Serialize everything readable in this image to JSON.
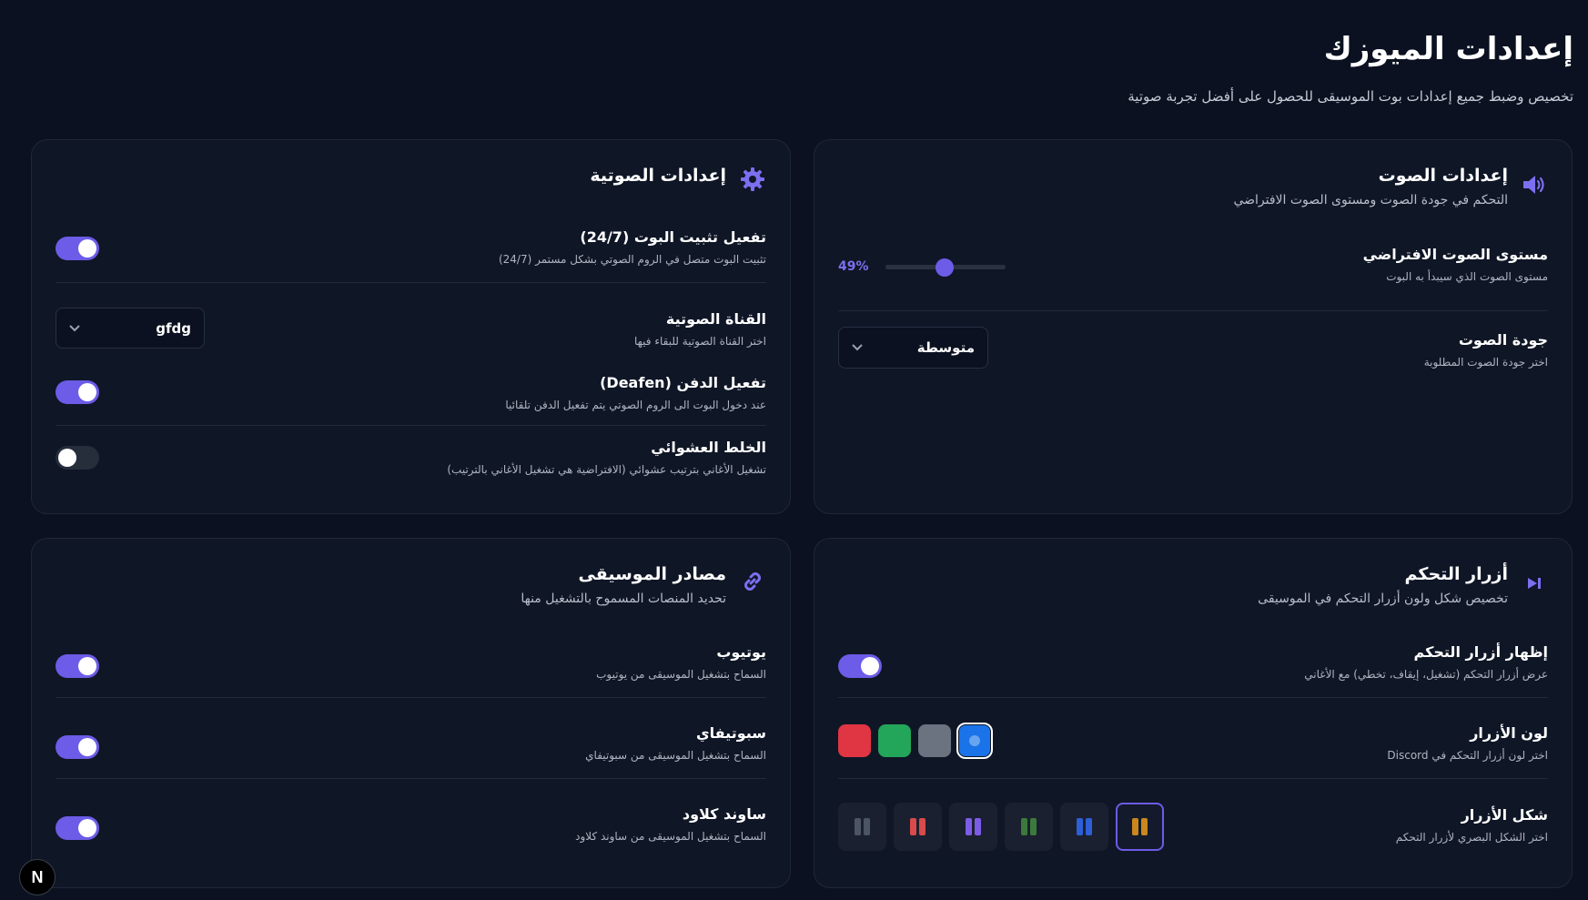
{
  "header": {
    "title": "إعدادات الميوزك",
    "subtitle": "تخصيص وضبط جميع إعدادات بوت الموسيقى للحصول على أفضل تجربة صوتية"
  },
  "audio_card": {
    "icon": "speaker-icon",
    "title": "إعدادات الصوت",
    "desc": "التحكم في جودة الصوت ومستوى الصوت الافتراضي",
    "volume": {
      "label": "مستوى الصوت الافتراضي",
      "desc": "مستوى الصوت الذي سيبدأ به البوت",
      "value": 49,
      "value_text": "49%"
    },
    "quality": {
      "label": "جودة الصوت",
      "desc": "اختر جودة الصوت المطلوبة",
      "value": "متوسطة"
    }
  },
  "voice_card": {
    "icon": "gear-icon",
    "title": "إعدادات الصوتية",
    "stay": {
      "label": "تفعيل تثبيت البوت (24/7)",
      "desc": "تثبيت البوت متصل في الروم الصوتي بشكل مستمر (24/7)",
      "on": true
    },
    "channel": {
      "label": "القناة الصوتية",
      "desc": "اختر القناة الصوتية للبقاء فيها",
      "value": "gfdg"
    },
    "deafen": {
      "label": "تفعيل الدفن (Deafen)",
      "desc": "عند دخول البوت الى الروم الصوتي يتم تفعيل الدفن تلقائيا",
      "on": true
    },
    "shuffle": {
      "label": "الخلط العشوائي",
      "desc": "تشغيل الأغاني بترتيب عشوائي (الافتراضية هي تشغيل الأغاني بالترتيب)",
      "on": false
    }
  },
  "control_card": {
    "icon": "skip-forward-icon",
    "title": "أزرار التحكم",
    "desc": "تخصيص شكل ولون أزرار التحكم في الموسيقى",
    "show": {
      "label": "إظهار أزرار التحكم",
      "desc": "عرض أزرار التحكم (تشغيل، إيقاف، تخطي) مع الأغاني",
      "on": true
    },
    "color": {
      "label": "لون الأزرار",
      "desc": "اختر لون أزرار التحكم في Discord",
      "options": [
        "#e03543",
        "#23a55a",
        "#6b7280",
        "#1a73e8"
      ],
      "selected_index": 3
    },
    "shape": {
      "label": "شكل الأزرار",
      "desc": "اختر الشكل البصري لأزرار التحكم",
      "options": [
        [
          "#4b5563",
          "#4b5563"
        ],
        [
          "#d94a4a",
          "#d94a4a"
        ],
        [
          "#7c5ce7",
          "#7c5ce7"
        ],
        [
          "#3b7a3b",
          "#3b7a3b"
        ],
        [
          "#2d5fd6",
          "#2d5fd6"
        ],
        [
          "#c9871d",
          "#c9871d"
        ]
      ],
      "selected_index": 5
    }
  },
  "sources_card": {
    "icon": "link-icon",
    "title": "مصادر الموسيقى",
    "desc": "تحديد المنصات المسموح بالتشغيل منها",
    "youtube": {
      "label": "يوتيوب",
      "desc": "السماح بتشغيل الموسيقى من يوتيوب",
      "on": true
    },
    "spotify": {
      "label": "سبوتيفاي",
      "desc": "السماح بتشغيل الموسيقى من سبوتيفاي",
      "on": true
    },
    "soundcloud": {
      "label": "ساوند كلاود",
      "desc": "السماح بتشغيل الموسيقى من ساوند كلاود",
      "on": true
    }
  },
  "badge": {
    "letter": "N"
  },
  "colors": {
    "accent": "#6c5ce7",
    "bg": "#0b1120",
    "card": "#0f1626"
  }
}
